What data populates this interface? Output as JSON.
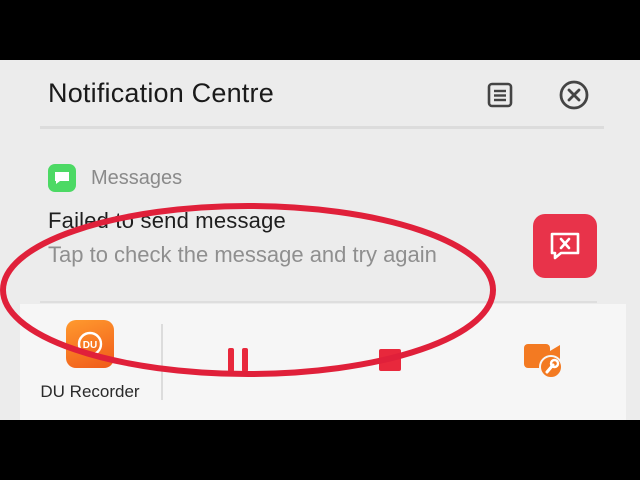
{
  "header": {
    "title": "Notification Centre",
    "manage_icon": "manage-notifications-icon",
    "close_icon": "close-circle-icon"
  },
  "notification": {
    "app_name": "Messages",
    "app_icon": "messages-bubble-icon",
    "title": "Failed to send message",
    "body": "Tap to check the message and try again",
    "action_icon": "message-error-icon"
  },
  "recorder": {
    "app_label": "DU Recorder",
    "controls": [
      "pause-icon",
      "stop-icon",
      "camera-tools-icon"
    ]
  },
  "colors": {
    "annotation_ellipse": "#e0203a",
    "action_button": "#e8334a",
    "messages_green": "#4cd964",
    "recorder_orange": "#f37a22",
    "control_red": "#e8283c"
  }
}
